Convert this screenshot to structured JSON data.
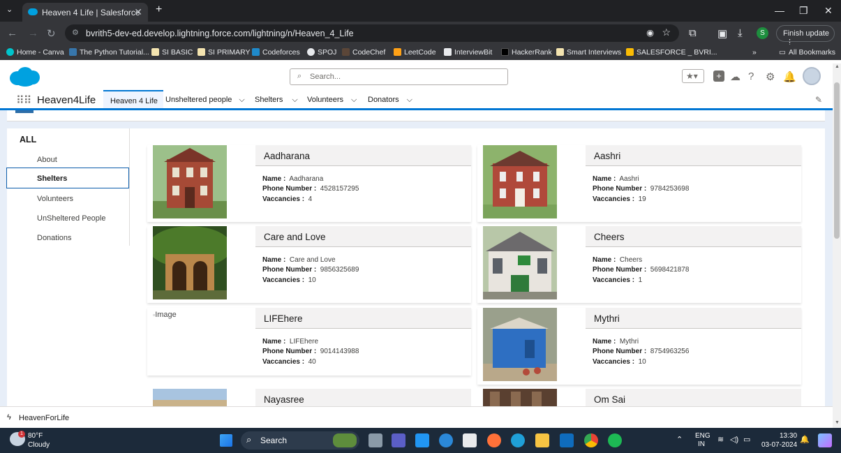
{
  "browser": {
    "tab_title": "Heaven 4 Life | Salesforce",
    "new_tab": "+",
    "url": "bvrith5-dev-ed.develop.lightning.force.com/lightning/n/Heaven_4_Life",
    "finish_update": "Finish update",
    "profile_letter": "S",
    "bookmarks": [
      "Home - Canva",
      "The Python Tutorial...",
      "SI BASIC",
      "SI PRIMARY",
      "Codeforces",
      "SPOJ",
      "CodeChef",
      "LeetCode",
      "InterviewBit",
      "HackerRank",
      "Smart Interviews",
      "SALESFORCE _ BVRI..."
    ],
    "all_bookmarks": "All Bookmarks"
  },
  "header": {
    "search_placeholder": "Search..."
  },
  "nav": {
    "app_name": "Heaven4Life",
    "tabs": [
      {
        "label": "Heaven 4 Life"
      },
      {
        "label": "Unsheltered people"
      },
      {
        "label": "Shelters"
      },
      {
        "label": "Volunteers"
      },
      {
        "label": "Donators"
      }
    ]
  },
  "sidebar": {
    "heading": "ALL",
    "items": [
      "About",
      "Shelters",
      "Volunteers",
      "UnSheltered People",
      "Donations"
    ],
    "selected": "Shelters"
  },
  "field_labels": {
    "name": "Name :",
    "phone": "Phone Number :",
    "vacancies": "Vaccancies :"
  },
  "shelters": [
    {
      "title": "Aadharana",
      "name": "Aadharana",
      "phone": "4528157295",
      "vacancies": "4"
    },
    {
      "title": "Aashri",
      "name": "Aashri",
      "phone": "9784253698",
      "vacancies": "19"
    },
    {
      "title": "Care and Love",
      "name": "Care and Love",
      "phone": "9856325689",
      "vacancies": "10"
    },
    {
      "title": "Cheers",
      "name": "Cheers",
      "phone": "5698421878",
      "vacancies": "1"
    },
    {
      "title": "LIFEhere",
      "name": "LIFEhere",
      "phone": "9014143988",
      "vacancies": "40",
      "broken_image_alt": "Image"
    },
    {
      "title": "Mythri",
      "name": "Mythri",
      "phone": "8754963256",
      "vacancies": "10"
    },
    {
      "title": "Nayasree"
    },
    {
      "title": "Om Sai"
    }
  ],
  "utility_bar": {
    "label": "HeavenForLife"
  },
  "taskbar": {
    "weather_temp": "80°F",
    "weather_desc": "Cloudy",
    "search": "Search",
    "lang": "ENG",
    "region": "IN",
    "time": "13:30",
    "date": "03-07-2024"
  }
}
